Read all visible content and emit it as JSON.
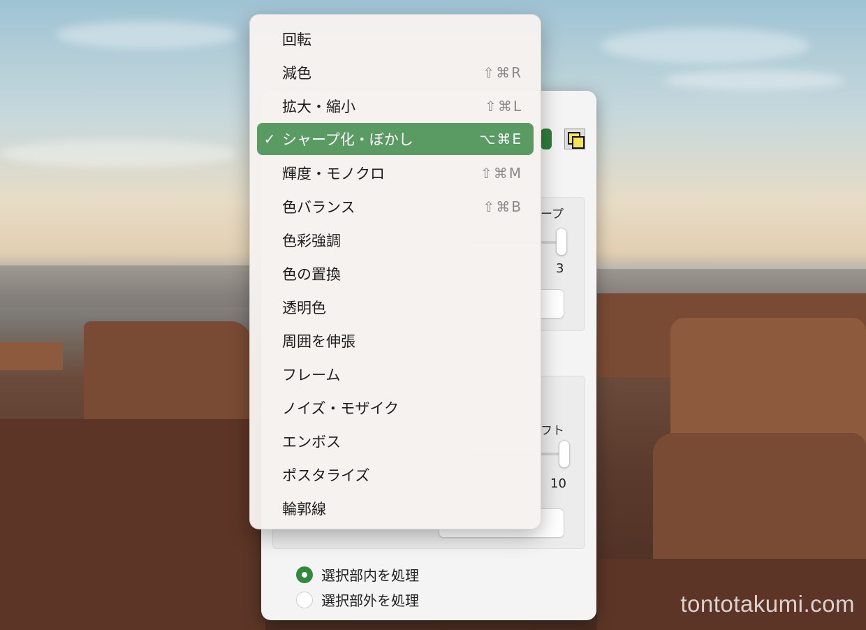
{
  "menu": {
    "items": [
      {
        "label": "回転",
        "shortcut": "",
        "checked": false
      },
      {
        "label": "減色",
        "shortcut": "⇧⌘R",
        "checked": false
      },
      {
        "label": "拡大・縮小",
        "shortcut": "⇧⌘L",
        "checked": false
      },
      {
        "label": "シャープ化・ぼかし",
        "shortcut": "⌥⌘E",
        "checked": true
      },
      {
        "label": "輝度・モノクロ",
        "shortcut": "⇧⌘M",
        "checked": false
      },
      {
        "label": "色バランス",
        "shortcut": "⇧⌘B",
        "checked": false
      },
      {
        "label": "色彩強調",
        "shortcut": "",
        "checked": false
      },
      {
        "label": "色の置換",
        "shortcut": "",
        "checked": false
      },
      {
        "label": "透明色",
        "shortcut": "",
        "checked": false
      },
      {
        "label": "周囲を伸張",
        "shortcut": "",
        "checked": false
      },
      {
        "label": "フレーム",
        "shortcut": "",
        "checked": false
      },
      {
        "label": "ノイズ・モザイク",
        "shortcut": "",
        "checked": false
      },
      {
        "label": "エンボス",
        "shortcut": "",
        "checked": false
      },
      {
        "label": "ポスタライズ",
        "shortcut": "",
        "checked": false
      },
      {
        "label": "輪郭線",
        "shortcut": "",
        "checked": false
      }
    ],
    "check_glyph": "✓",
    "selected_color": "#5a9a63"
  },
  "panel": {
    "group1_label_tail": "ープ",
    "group1_value": "3",
    "group2_label_tail": "フト",
    "group2_value": "10",
    "radio_options": [
      {
        "label": "選択部内を処理",
        "selected": true
      },
      {
        "label": "選択部外を処理",
        "selected": false
      }
    ],
    "accent_color": "#2f8a3e"
  },
  "watermark": "tontotakumi.com"
}
